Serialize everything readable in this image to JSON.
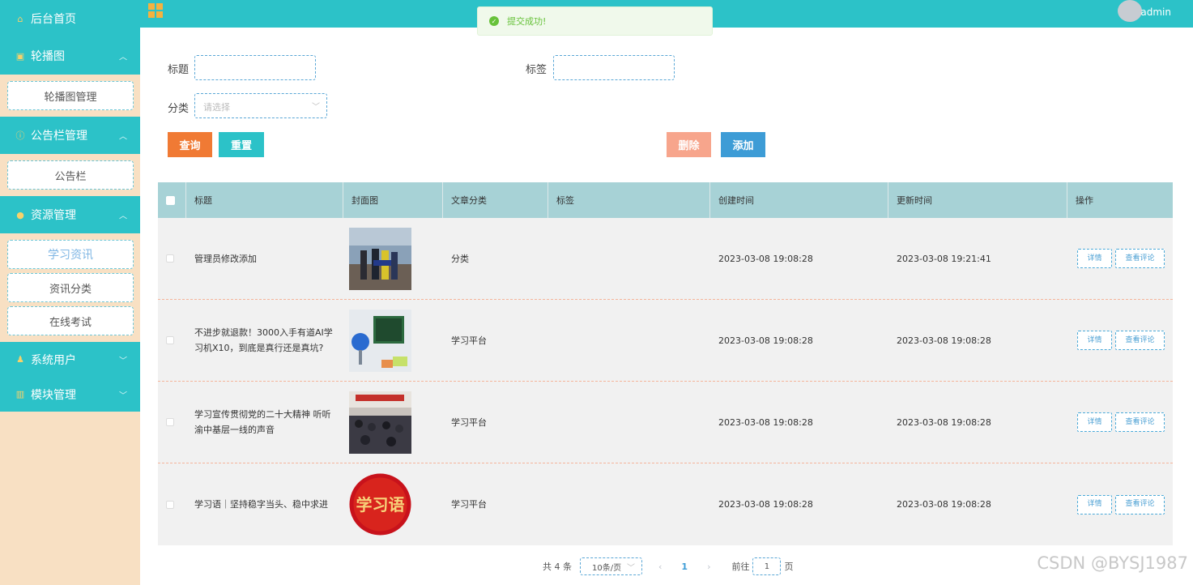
{
  "sidebar": {
    "home": "后台首页",
    "groups": [
      {
        "label": "轮播图",
        "items": [
          "轮播图管理"
        ]
      },
      {
        "label": "公告栏管理",
        "items": [
          "公告栏"
        ]
      },
      {
        "label": "资源管理",
        "items": [
          "学习资讯",
          "资讯分类",
          "在线考试"
        ]
      }
    ],
    "system_users": "系统用户",
    "module_mgmt": "模块管理"
  },
  "topbar": {
    "username": "admin"
  },
  "toast": {
    "message": "提交成功!"
  },
  "search": {
    "title_label": "标题",
    "tag_label": "标签",
    "category_label": "分类",
    "category_placeholder": "请选择"
  },
  "buttons": {
    "query": "查询",
    "reset": "重置",
    "delete": "删除",
    "add": "添加"
  },
  "table": {
    "headers": [
      "标题",
      "封面图",
      "文章分类",
      "标签",
      "创建时间",
      "更新时间",
      "操作"
    ],
    "rows": [
      {
        "title": "管理员修改添加",
        "category": "分类",
        "tag": "",
        "created": "2023-03-08 19:08:28",
        "updated": "2023-03-08 19:21:41"
      },
      {
        "title": "不进步就退款！3000入手有道AI学习机X10，到底是真行还是真坑?",
        "category": "学习平台",
        "tag": "",
        "created": "2023-03-08 19:08:28",
        "updated": "2023-03-08 19:08:28"
      },
      {
        "title": "学习宣传贯彻党的二十大精神 听听渝中基层一线的声音",
        "category": "学习平台",
        "tag": "",
        "created": "2023-03-08 19:08:28",
        "updated": "2023-03-08 19:08:28"
      },
      {
        "title": "学习语｜坚持稳字当头、稳中求进",
        "category": "学习平台",
        "tag": "",
        "created": "2023-03-08 19:08:28",
        "updated": "2023-03-08 19:08:28"
      }
    ],
    "row_actions": {
      "detail": "详情",
      "comments": "查看评论"
    },
    "cover_text_row4": "学习语"
  },
  "pagination": {
    "total": "共 4 条",
    "page_size": "10条/页",
    "current": "1",
    "goto_label": "前往",
    "goto_value": "1",
    "page_suffix": "页"
  },
  "watermark": "CSDN @BYSJ1987",
  "colors": {
    "sidebar_bg": "#f8e0c3",
    "accent": "#2cc2c8",
    "query_btn": "#f07a34",
    "reset_btn": "#2cc2c8",
    "delete_btn": "#f7a58c",
    "add_btn": "#3d9cd6",
    "table_header": "#a7d2d6"
  }
}
